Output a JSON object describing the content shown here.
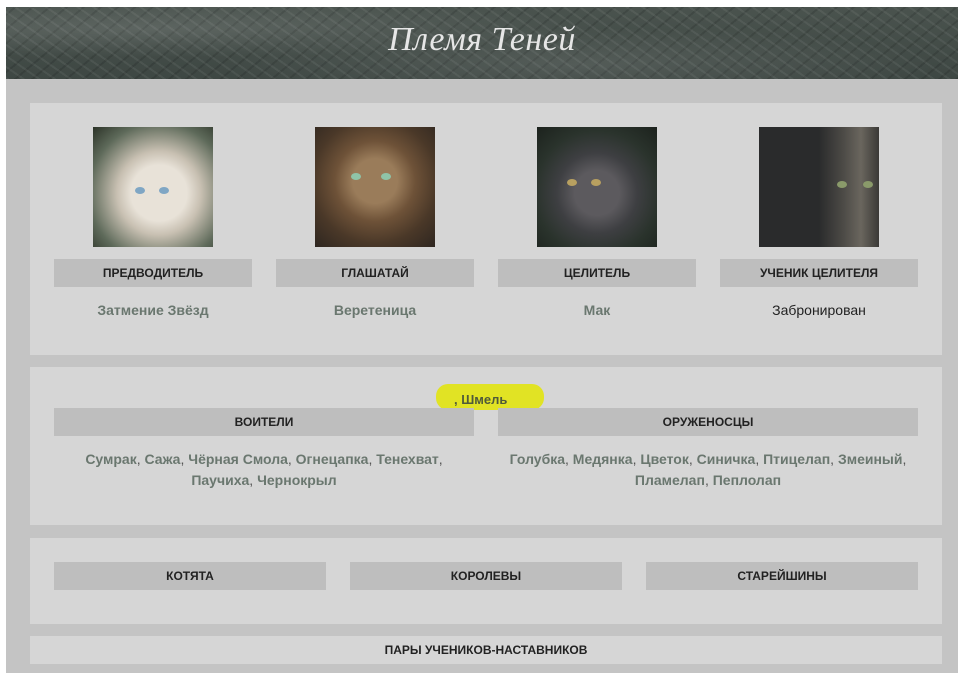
{
  "header": {
    "title": "Племя Теней"
  },
  "leaders": [
    {
      "role": "Предводитель",
      "name": "Затмение Звёзд",
      "photo": "siamese-cat-photo"
    },
    {
      "role": "Глашатай",
      "name": "Веретеница",
      "photo": "bengal-cat-photo"
    },
    {
      "role": "Целитель",
      "name": "Мак",
      "photo": "dark-cat-photo"
    },
    {
      "role": "Ученик целителя",
      "name": "Забронирован",
      "photo": "shadow-cat-photo"
    }
  ],
  "ranks": {
    "highlight": ", Шмель",
    "warriors": {
      "label": "Воители",
      "members": [
        "Сумрак",
        "Сажа",
        "Чёрная Смола",
        "Огнецапка",
        "Тенехват",
        "Паучиха",
        "Чернокрыл"
      ]
    },
    "apprentices": {
      "label": "Оруженосцы",
      "members": [
        "Голубка",
        "Медянка",
        "Цветок",
        "Синичка",
        "Птицелап",
        "Змеиный",
        "Пламелап",
        "Пеплолап"
      ]
    }
  },
  "groups": [
    "Котята",
    "Королевы",
    "Старейшины"
  ],
  "pairs": {
    "label": "Пары учеников-наставников"
  }
}
